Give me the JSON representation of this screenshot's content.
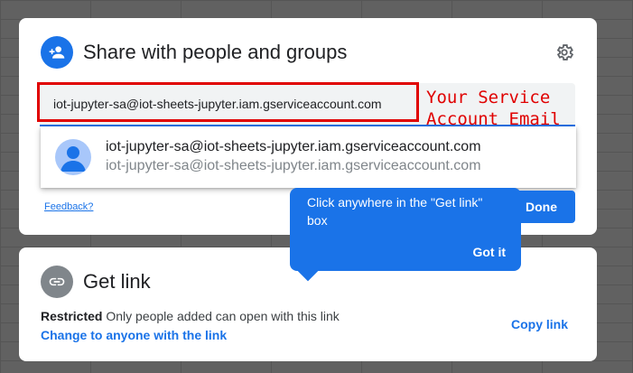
{
  "share": {
    "title": "Share with people and groups",
    "input_value": "iot-jupyter-sa@iot-sheets-jupyter.iam.gserviceaccount.com",
    "suggestion": {
      "name": "iot-jupyter-sa@iot-sheets-jupyter.iam.gserviceaccount.com",
      "email": "iot-jupyter-sa@iot-sheets-jupyter.iam.gserviceaccount.com"
    },
    "feedback_label": "Feedback?",
    "done_label": "Done"
  },
  "annotation": {
    "line1": "Your Service",
    "line2": "Account Email",
    "color": "#e00000"
  },
  "tooltip": {
    "text": "Click anywhere in the \"Get link\" box",
    "button_label": "Got it"
  },
  "get_link": {
    "title": "Get link",
    "restriction_label": "Restricted",
    "restriction_desc": "Only people added can open with this link",
    "change_label": "Change to anyone with the link",
    "copy_label": "Copy link"
  },
  "colors": {
    "accent": "#1a73e8",
    "link_icon_bg": "#80868b"
  },
  "icons": {
    "share": "person-add-icon",
    "settings": "gear-icon",
    "avatar": "person-avatar-icon",
    "link": "link-icon"
  }
}
